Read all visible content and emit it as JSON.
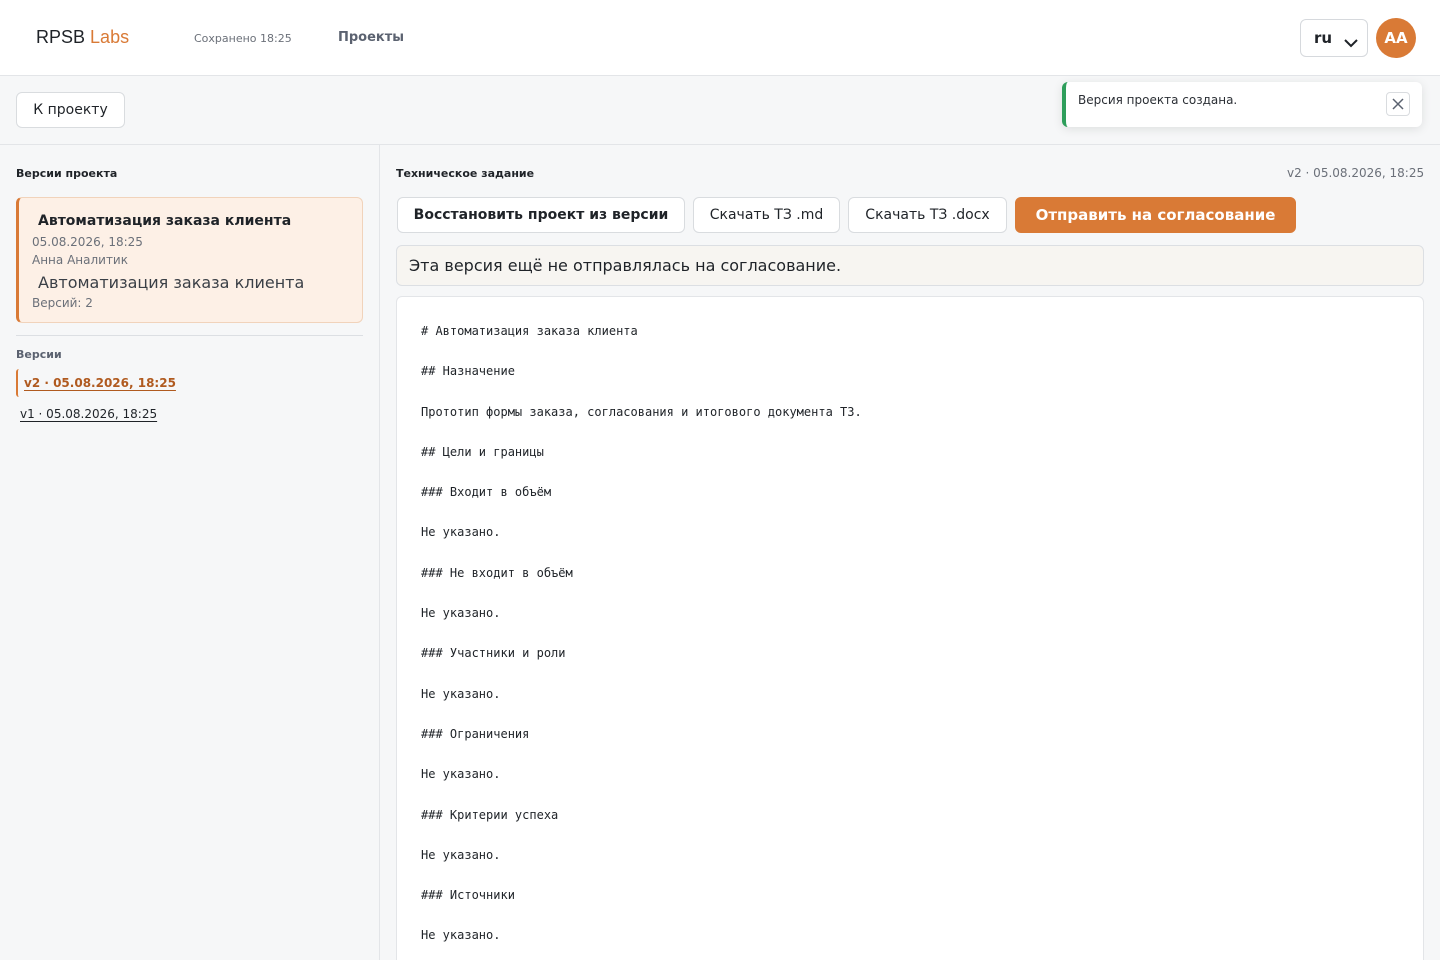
{
  "header": {
    "logo_main": "RPSB",
    "logo_accent": "Labs",
    "saved_status": "Сохранено 18:25",
    "nav_projects": "Проекты",
    "language": "ru",
    "avatar_initials": "AA"
  },
  "subbar": {
    "back_label": "К проекту"
  },
  "toast": {
    "message": "Версия проекта создана."
  },
  "sidebar": {
    "title": "Версии проекта",
    "project": {
      "name": "Автоматизация заказа клиента",
      "date": "05.08.2026, 18:25",
      "author": "Анна Аналитик",
      "description": "Автоматизация заказа клиента",
      "versions_count": "Версий: 2"
    },
    "versions_title": "Версии",
    "versions": [
      {
        "label": "v2 · 05.08.2026, 18:25",
        "active": true
      },
      {
        "label": "v1 · 05.08.2026, 18:25",
        "active": false
      }
    ]
  },
  "main": {
    "title": "Техническое задание",
    "meta": "v2 · 05.08.2026, 18:25",
    "buttons": {
      "restore": "Восстановить проект из версии",
      "download_md": "Скачать ТЗ .md",
      "download_docx": "Скачать ТЗ .docx",
      "send_approval": "Отправить на согласование"
    },
    "notice": "Эта версия ещё не отправлялась на согласование.",
    "document_lines": [
      "# Автоматизация заказа клиента",
      "## Назначение",
      "Прототип формы заказа, согласования и итогового документа ТЗ.",
      "## Цели и границы",
      "### Входит в объём",
      "Не указано.",
      "### Не входит в объём",
      "Не указано.",
      "### Участники и роли",
      "Не указано.",
      "### Ограничения",
      "Не указано.",
      "### Критерии успеха",
      "Не указано.",
      "### Источники",
      "Не указано."
    ]
  },
  "colors": {
    "accent": "#d97a36",
    "success": "#2e9e5b",
    "card_bg": "#fdf0e6"
  }
}
